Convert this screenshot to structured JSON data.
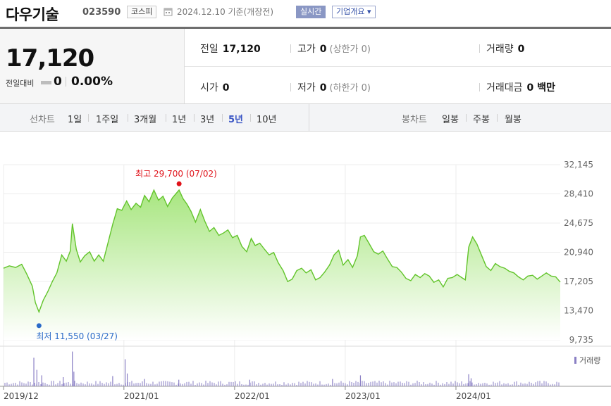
{
  "header": {
    "company_name": "다우기술",
    "stock_code": "023590",
    "market_badge": "코스피",
    "calendar_icon": "calendar-icon",
    "date_text": "2024.12.10 기준(개장전)",
    "realtime_button": "실시간",
    "overview_button": "기업개요 ▾"
  },
  "quote": {
    "price": "17,120",
    "change_label": "전일대비",
    "change_value": "0",
    "change_pct": "0.00%",
    "prev_close_label": "전일",
    "prev_close": "17,120",
    "high_label": "고가",
    "high": "0",
    "upper_limit": "(상한가 0)",
    "volume_label": "거래량",
    "volume": "0",
    "open_label": "시가",
    "open": "0",
    "low_label": "저가",
    "low": "0",
    "lower_limit": "(하한가 0)",
    "amount_label": "거래대금",
    "amount": "0 백만"
  },
  "periods": {
    "line_label": "선차트",
    "line_tabs": [
      "1일",
      "1주일",
      "3개월",
      "1년",
      "3년",
      "5년",
      "10년"
    ],
    "active_tab": "5년",
    "candle_label": "봉차트",
    "candle_tabs": [
      "일봉",
      "주봉",
      "월봉"
    ]
  },
  "chart_data": {
    "type": "area",
    "title": "",
    "x_tick_labels": [
      "2019/12",
      "2021/01",
      "2022/01",
      "2023/01",
      "2024/01"
    ],
    "y_tick_labels": [
      "32,145",
      "28,410",
      "24,675",
      "20,940",
      "17,205",
      "13,470",
      "9,735"
    ],
    "ylim": [
      9735,
      32145
    ],
    "grid": true,
    "colors": {
      "line": "#62c42b",
      "fill_top": "#a8e680",
      "fill_bottom": "#ffffff",
      "max_marker": "#e0131a",
      "min_marker": "#2a6ac8",
      "volume": "#8a7fc4"
    },
    "max_annotation": "최고 29,700 (07/02)",
    "min_annotation": "최저 11,550 (03/27)",
    "max_point": {
      "x": "2021-07-02",
      "y": 29700
    },
    "min_point": {
      "x": "2020-03-27",
      "y": 11550
    },
    "x_ticks": [
      "2019-12-01",
      "2021-01-01",
      "2022-01-01",
      "2023-01-01",
      "2024-01-01"
    ],
    "x_range": [
      "2019-12-01",
      "2024-12-10"
    ],
    "volume_label": "거래량",
    "series": [
      {
        "points": [
          [
            "2019-12-01",
            18900
          ],
          [
            "2019-12-20",
            19200
          ],
          [
            "2020-01-10",
            19000
          ],
          [
            "2020-01-30",
            19400
          ],
          [
            "2020-02-15",
            18200
          ],
          [
            "2020-03-05",
            16600
          ],
          [
            "2020-03-15",
            14500
          ],
          [
            "2020-03-27",
            13300
          ],
          [
            "2020-04-10",
            14800
          ],
          [
            "2020-04-25",
            15900
          ],
          [
            "2020-05-10",
            17200
          ],
          [
            "2020-05-25",
            18300
          ],
          [
            "2020-06-10",
            20600
          ],
          [
            "2020-06-25",
            19800
          ],
          [
            "2020-07-08",
            21100
          ],
          [
            "2020-07-15",
            24600
          ],
          [
            "2020-07-28",
            21300
          ],
          [
            "2020-08-10",
            19700
          ],
          [
            "2020-08-25",
            20500
          ],
          [
            "2020-09-10",
            21000
          ],
          [
            "2020-09-25",
            19800
          ],
          [
            "2020-10-10",
            20600
          ],
          [
            "2020-10-25",
            19800
          ],
          [
            "2020-11-10",
            22200
          ],
          [
            "2020-11-25",
            24500
          ],
          [
            "2020-12-10",
            26500
          ],
          [
            "2020-12-25",
            26300
          ],
          [
            "2021-01-10",
            27500
          ],
          [
            "2021-01-25",
            26400
          ],
          [
            "2021-02-10",
            27200
          ],
          [
            "2021-02-25",
            26700
          ],
          [
            "2021-03-10",
            28200
          ],
          [
            "2021-03-25",
            27400
          ],
          [
            "2021-04-10",
            28900
          ],
          [
            "2021-04-25",
            27600
          ],
          [
            "2021-05-10",
            28100
          ],
          [
            "2021-05-25",
            26800
          ],
          [
            "2021-06-10",
            27900
          ],
          [
            "2021-07-02",
            28900
          ],
          [
            "2021-07-15",
            27800
          ],
          [
            "2021-07-28",
            27100
          ],
          [
            "2021-08-10",
            26200
          ],
          [
            "2021-08-25",
            24800
          ],
          [
            "2021-09-10",
            26400
          ],
          [
            "2021-09-25",
            24900
          ],
          [
            "2021-10-10",
            23600
          ],
          [
            "2021-10-25",
            24100
          ],
          [
            "2021-11-10",
            23100
          ],
          [
            "2021-11-25",
            23400
          ],
          [
            "2021-12-10",
            23800
          ],
          [
            "2021-12-25",
            22800
          ],
          [
            "2022-01-10",
            23100
          ],
          [
            "2022-01-25",
            21700
          ],
          [
            "2022-02-10",
            21000
          ],
          [
            "2022-02-25",
            22700
          ],
          [
            "2022-03-10",
            21800
          ],
          [
            "2022-03-25",
            22100
          ],
          [
            "2022-04-10",
            21300
          ],
          [
            "2022-04-25",
            20600
          ],
          [
            "2022-05-10",
            20900
          ],
          [
            "2022-05-25",
            19600
          ],
          [
            "2022-06-10",
            18600
          ],
          [
            "2022-06-25",
            17200
          ],
          [
            "2022-07-10",
            17500
          ],
          [
            "2022-07-25",
            18600
          ],
          [
            "2022-08-10",
            18900
          ],
          [
            "2022-08-25",
            18300
          ],
          [
            "2022-09-10",
            18700
          ],
          [
            "2022-09-25",
            17400
          ],
          [
            "2022-10-10",
            17700
          ],
          [
            "2022-10-25",
            18400
          ],
          [
            "2022-11-10",
            19300
          ],
          [
            "2022-11-25",
            20600
          ],
          [
            "2022-12-10",
            21200
          ],
          [
            "2022-12-25",
            19300
          ],
          [
            "2023-01-10",
            20000
          ],
          [
            "2023-01-25",
            19000
          ],
          [
            "2023-02-10",
            20500
          ],
          [
            "2023-02-20",
            22900
          ],
          [
            "2023-03-05",
            23100
          ],
          [
            "2023-03-20",
            22100
          ],
          [
            "2023-04-05",
            21000
          ],
          [
            "2023-04-20",
            20700
          ],
          [
            "2023-05-05",
            21100
          ],
          [
            "2023-05-20",
            20100
          ],
          [
            "2023-06-05",
            19100
          ],
          [
            "2023-06-20",
            19000
          ],
          [
            "2023-07-05",
            18400
          ],
          [
            "2023-07-20",
            17600
          ],
          [
            "2023-08-05",
            17300
          ],
          [
            "2023-08-20",
            18100
          ],
          [
            "2023-09-05",
            17700
          ],
          [
            "2023-09-20",
            18200
          ],
          [
            "2023-10-05",
            17900
          ],
          [
            "2023-10-20",
            17100
          ],
          [
            "2023-11-05",
            17400
          ],
          [
            "2023-11-20",
            16500
          ],
          [
            "2023-12-05",
            17600
          ],
          [
            "2023-12-20",
            17700
          ],
          [
            "2024-01-05",
            18100
          ],
          [
            "2024-01-20",
            17700
          ],
          [
            "2024-02-01",
            17400
          ],
          [
            "2024-02-12",
            21600
          ],
          [
            "2024-02-25",
            22900
          ],
          [
            "2024-03-10",
            22000
          ],
          [
            "2024-03-25",
            20600
          ],
          [
            "2024-04-10",
            19100
          ],
          [
            "2024-04-25",
            18600
          ],
          [
            "2024-05-10",
            19500
          ],
          [
            "2024-05-25",
            19100
          ],
          [
            "2024-06-10",
            18900
          ],
          [
            "2024-06-25",
            18500
          ],
          [
            "2024-07-10",
            18300
          ],
          [
            "2024-07-25",
            17800
          ],
          [
            "2024-08-10",
            17400
          ],
          [
            "2024-08-25",
            17900
          ],
          [
            "2024-09-10",
            18000
          ],
          [
            "2024-09-25",
            17500
          ],
          [
            "2024-10-10",
            17900
          ],
          [
            "2024-10-25",
            18300
          ],
          [
            "2024-11-10",
            17900
          ],
          [
            "2024-11-25",
            17800
          ],
          [
            "2024-12-10",
            17120
          ]
        ]
      }
    ],
    "volume_spikes": [
      [
        "2020-03-10",
        0.78
      ],
      [
        "2020-03-20",
        0.45
      ],
      [
        "2020-04-05",
        0.3
      ],
      [
        "2020-06-15",
        0.25
      ],
      [
        "2020-07-15",
        0.95
      ],
      [
        "2020-07-20",
        0.4
      ],
      [
        "2020-11-25",
        0.28
      ],
      [
        "2021-01-05",
        0.74
      ],
      [
        "2021-01-12",
        0.35
      ],
      [
        "2021-03-10",
        0.2
      ],
      [
        "2021-07-01",
        0.18
      ],
      [
        "2022-02-20",
        0.18
      ],
      [
        "2022-11-20",
        0.2
      ],
      [
        "2023-02-20",
        0.3
      ],
      [
        "2024-02-12",
        0.33
      ],
      [
        "2024-02-20",
        0.22
      ]
    ]
  }
}
